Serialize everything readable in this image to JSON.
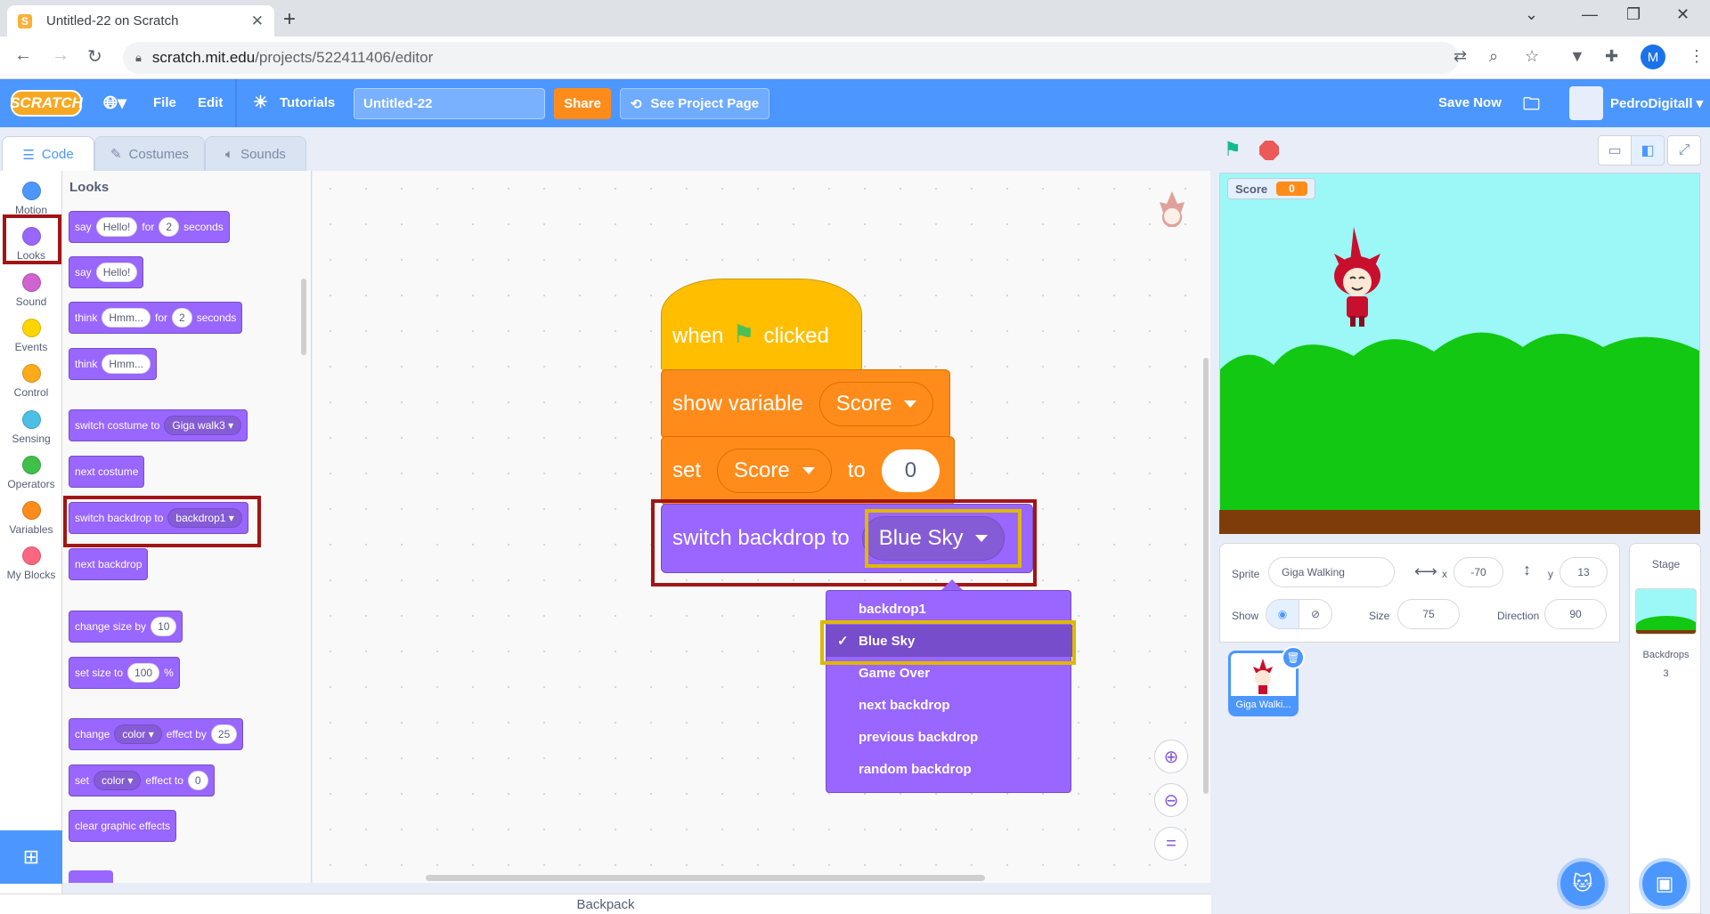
{
  "browser": {
    "tab_title": "Untitled-22 on Scratch",
    "url_host": "scratch.mit.edu",
    "url_path": "/projects/522411406/editor",
    "profile_initial": "M"
  },
  "menubar": {
    "logo": "SCRATCH",
    "file": "File",
    "edit": "Edit",
    "tutorials": "Tutorials",
    "project_title": "Untitled-22",
    "share": "Share",
    "see_project_page": "See Project Page",
    "save_now": "Save Now",
    "username": "PedroDigitall"
  },
  "editor_tabs": {
    "code": "Code",
    "costumes": "Costumes",
    "sounds": "Sounds"
  },
  "categories": [
    {
      "label": "Motion",
      "color": "#4c97ff"
    },
    {
      "label": "Looks",
      "color": "#9966ff"
    },
    {
      "label": "Sound",
      "color": "#cf63cf"
    },
    {
      "label": "Events",
      "color": "#ffd500"
    },
    {
      "label": "Control",
      "color": "#ffab19"
    },
    {
      "label": "Sensing",
      "color": "#4cbfe6"
    },
    {
      "label": "Operators",
      "color": "#40bf4a"
    },
    {
      "label": "Variables",
      "color": "#ff8c1a"
    },
    {
      "label": "My Blocks",
      "color": "#ff6680"
    }
  ],
  "palette": {
    "title": "Looks",
    "say_for": {
      "say": "say",
      "msg": "Hello!",
      "for": "for",
      "secs": "2",
      "seconds": "seconds"
    },
    "say": {
      "say": "say",
      "msg": "Hello!"
    },
    "think_for": {
      "think": "think",
      "msg": "Hmm...",
      "for": "for",
      "secs": "2",
      "seconds": "seconds"
    },
    "think": {
      "think": "think",
      "msg": "Hmm..."
    },
    "switch_costume": {
      "label": "switch costume to",
      "value": "Giga walk3"
    },
    "next_costume": "next costume",
    "switch_backdrop": {
      "label": "switch backdrop to",
      "value": "backdrop1"
    },
    "next_backdrop": "next backdrop",
    "change_size": {
      "label": "change size by",
      "value": "10"
    },
    "set_size": {
      "label": "set size to",
      "value": "100",
      "unit": "%"
    },
    "change_effect": {
      "change": "change",
      "effect": "color",
      "by": "effect by",
      "value": "25"
    },
    "set_effect": {
      "set": "set",
      "effect": "color",
      "to": "effect to",
      "value": "0"
    },
    "clear_effects": "clear graphic effects"
  },
  "script": {
    "when": "when",
    "clicked": "clicked",
    "show_variable": "show variable",
    "show_variable_value": "Score",
    "set": "set",
    "set_var": "Score",
    "to": "to",
    "set_value": "0",
    "switch_backdrop": "switch backdrop to",
    "switch_backdrop_value": "Blue Sky"
  },
  "dropdown": {
    "items": [
      "backdrop1",
      "Blue Sky",
      "Game Over",
      "next backdrop",
      "previous backdrop",
      "random backdrop"
    ],
    "selected": "Blue Sky",
    "check": "✓"
  },
  "backpack": "Backpack",
  "stage": {
    "monitor_label": "Score",
    "monitor_value": "0",
    "sky_color": "#9cf8f6",
    "hill_color": "#12c812",
    "ground_color": "#7d3c0a"
  },
  "sprite_info": {
    "sprite_label": "Sprite",
    "sprite_name": "Giga Walking",
    "x_label": "x",
    "x": "-70",
    "y_label": "y",
    "y": "13",
    "show_label": "Show",
    "size_label": "Size",
    "size": "75",
    "direction_label": "Direction",
    "direction": "90",
    "thumb_name": "Giga Walki..."
  },
  "stage_panel": {
    "title": "Stage",
    "backdrops_label": "Backdrops",
    "backdrops_count": "3"
  }
}
